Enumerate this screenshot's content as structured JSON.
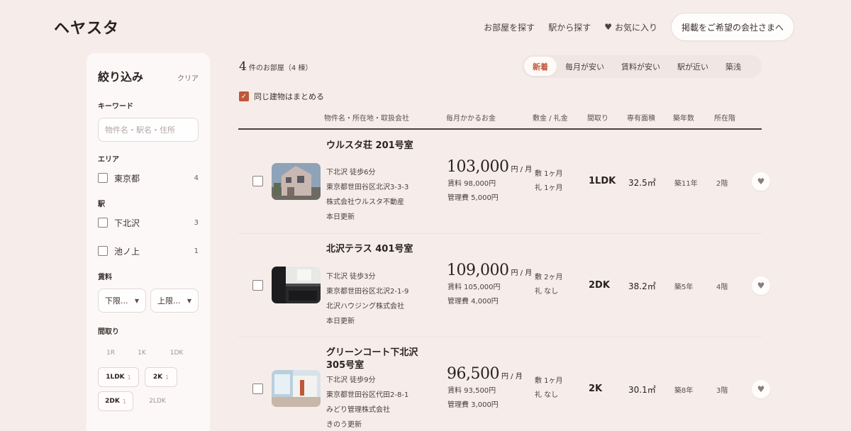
{
  "header": {
    "logo": "ヘヤスタ",
    "nav": [
      {
        "label": "お部屋を探す"
      },
      {
        "label": "駅から探す"
      },
      {
        "label": "お気に入り"
      }
    ],
    "cta_label": "掲載をご希望の会社さまへ"
  },
  "sidebar": {
    "title": "絞り込み",
    "clear_label": "クリア",
    "keyword_label": "キーワード",
    "keyword_placeholder": "物件名・駅名・住所",
    "area_label": "エリア",
    "areas": [
      {
        "label": "東京都",
        "count": "4"
      }
    ],
    "station_label": "駅",
    "stations": [
      {
        "label": "下北沢",
        "count": "3"
      },
      {
        "label": "池ノ上",
        "count": "1"
      }
    ],
    "rent_label": "賃料",
    "rent_min": "下限...",
    "rent_max": "上限...",
    "layout_label": "間取り",
    "layout_chips": [
      {
        "label": "1R",
        "count": "",
        "enabled": false
      },
      {
        "label": "1K",
        "count": "",
        "enabled": false
      },
      {
        "label": "1DK",
        "count": "",
        "enabled": false
      },
      {
        "label": "1LDK",
        "count": "1",
        "enabled": true
      },
      {
        "label": "2K",
        "count": "1",
        "enabled": true
      },
      {
        "label": "2DK",
        "count": "1",
        "enabled": true
      },
      {
        "label": "2LDK",
        "count": "",
        "enabled": false
      }
    ]
  },
  "results": {
    "count": "4",
    "count_suffix": "件のお部屋（4 棟）",
    "sort_tabs": [
      "新着",
      "毎月が安い",
      "賃料が安い",
      "駅が近い",
      "築浅"
    ],
    "active_sort": "新着",
    "group_label": "同じ建物はまとめる",
    "columns": [
      "物件名・所在地・取扱会社",
      "毎月かかるお金",
      "敷金 / 礼金",
      "間取り",
      "専有面積",
      "築年数",
      "所在階"
    ]
  },
  "listings": [
    {
      "name": "ウルスタ荘 201号室",
      "station": "下北沢 徒歩6分",
      "address": "東京都世田谷区北沢3-3-3",
      "company": "株式会社ウルスタ不動産",
      "updated": "本日更新",
      "monthly": "103,000",
      "monthly_unit": "円 / 月",
      "rent": "賃料 98,000円",
      "fee": "管理費 5,000円",
      "deposit": "敷 1ヶ月",
      "key_money": "礼 1ヶ月",
      "layout": "1LDK",
      "area": "32.5㎡",
      "age": "築11年",
      "floor": "2階",
      "thumb": "house"
    },
    {
      "name": "北沢テラス 401号室",
      "station": "下北沢 徒歩3分",
      "address": "東京都世田谷区北沢2-1-9",
      "company": "北沢ハウジング株式会社",
      "updated": "本日更新",
      "monthly": "109,000",
      "monthly_unit": "円 / 月",
      "rent": "賃料 105,000円",
      "fee": "管理費 4,000円",
      "deposit": "敷 2ヶ月",
      "key_money": "礼 なし",
      "layout": "2DK",
      "area": "38.2㎡",
      "age": "築5年",
      "floor": "4階",
      "thumb": "kitchen"
    },
    {
      "name": "グリーンコート下北沢 305号室",
      "station": "下北沢 徒歩9分",
      "address": "東京都世田谷区代田2-8-1",
      "company": "みどり管理株式会社",
      "updated": "きのう更新",
      "monthly": "96,500",
      "monthly_unit": "円 / 月",
      "rent": "賃料 93,500円",
      "fee": "管理費 3,000円",
      "deposit": "敷 1ヶ月",
      "key_money": "礼 なし",
      "layout": "2K",
      "area": "30.1㎡",
      "age": "築8年",
      "floor": "3階",
      "thumb": "room"
    }
  ],
  "colors": {
    "background": "#f6edea",
    "accent": "#c0573a",
    "text": "#2a2220"
  }
}
